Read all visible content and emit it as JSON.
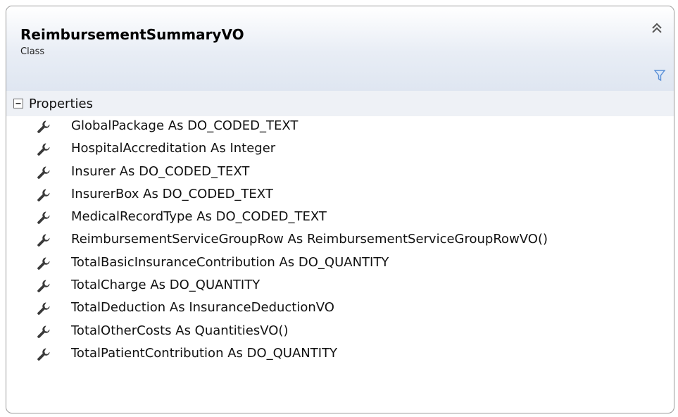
{
  "header": {
    "title": "ReimbursementSummaryVO",
    "subtitle": "Class"
  },
  "section": {
    "label": "Properties"
  },
  "properties": [
    "GlobalPackage As DO_CODED_TEXT",
    "HospitalAccreditation As Integer",
    "Insurer As DO_CODED_TEXT",
    "InsurerBox As DO_CODED_TEXT",
    "MedicalRecordType As DO_CODED_TEXT",
    "ReimbursementServiceGroupRow  As  ReimbursementServiceGroupRowVO()",
    "TotalBasicInsuranceContribution As DO_QUANTITY",
    "TotalCharge As DO_QUANTITY",
    "TotalDeduction As InsuranceDeductionVO",
    "TotalOtherCosts As QuantitiesVO()",
    "TotalPatientContribution As DO_QUANTITY"
  ],
  "icons": {
    "collapse": "double-chevron-up-icon",
    "filter": "filter-icon",
    "toggle": "minus-box-icon",
    "property": "wrench-icon"
  },
  "colors": {
    "header_gradient_end": "#dfe6f1",
    "section_bg": "#eef1f6",
    "filter_blue": "#5a8fd6"
  }
}
